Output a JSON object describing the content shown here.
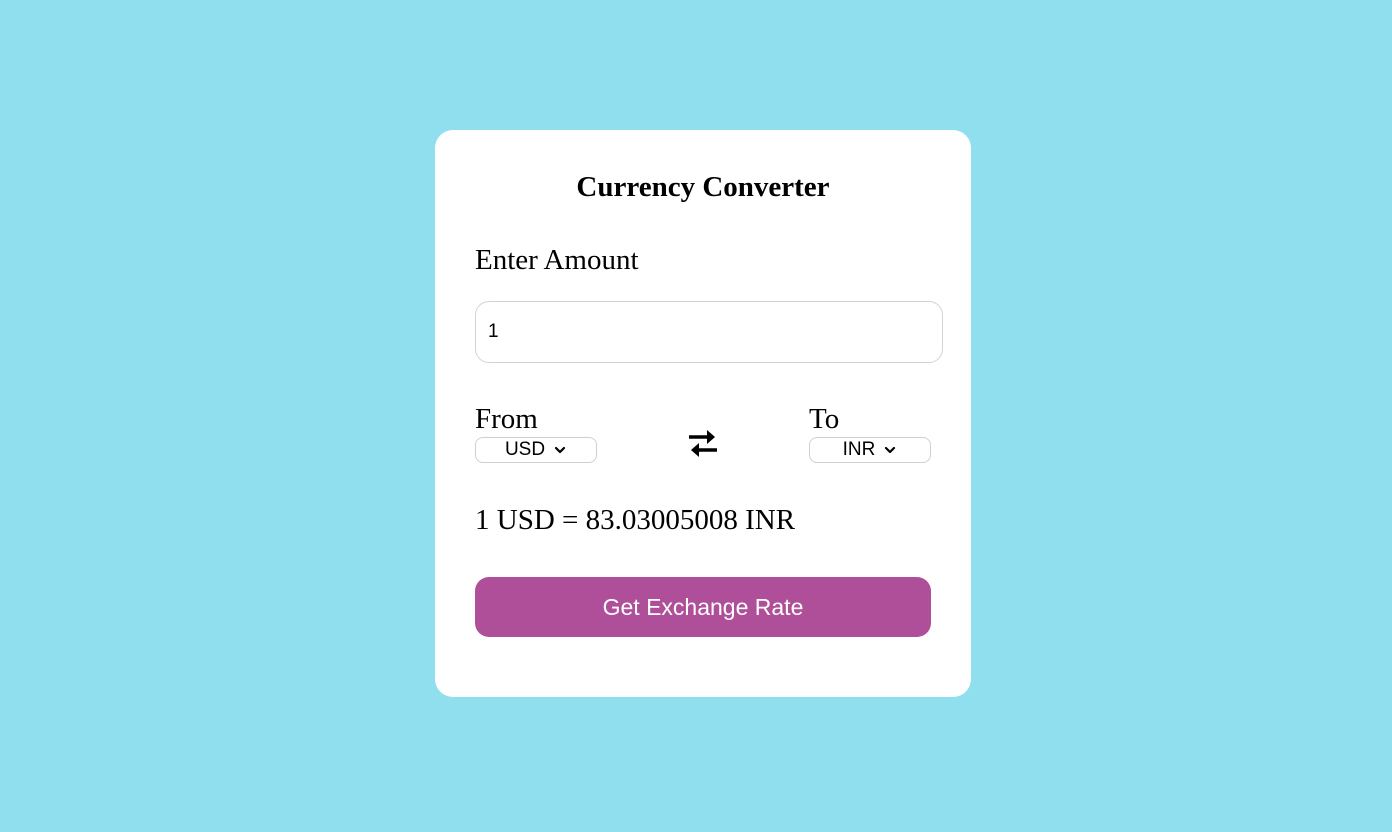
{
  "converter": {
    "title": "Currency Converter",
    "amount_label": "Enter Amount",
    "amount_value": "1",
    "from_label": "From",
    "from_currency": "USD",
    "to_label": "To",
    "to_currency": "INR",
    "result_text": "1 USD = 83.03005008 INR",
    "button_label": "Get Exchange Rate"
  },
  "icons": {
    "swap": "swap-arrows-icon",
    "chevron": "chevron-down-icon"
  },
  "colors": {
    "background": "#90dfee",
    "card": "#ffffff",
    "button": "#b04f99",
    "button_text": "#ffffff"
  }
}
